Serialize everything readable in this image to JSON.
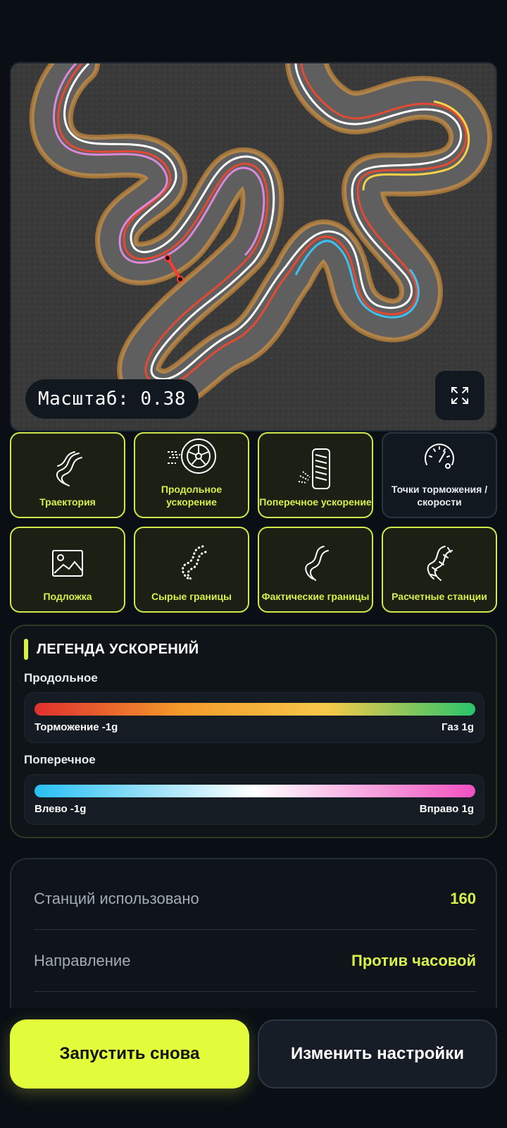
{
  "map": {
    "scale_text": "Масштаб: 0.38",
    "expand_icon": "expand-icon"
  },
  "layers": [
    {
      "label": "Траектория",
      "icon": "trajectory-icon",
      "active": true
    },
    {
      "label": "Продольное ускорение",
      "icon": "wheel-icon",
      "active": true
    },
    {
      "label": "Поперечное ускорение",
      "icon": "tire-icon",
      "active": true
    },
    {
      "label": "Точки торможения / скорости",
      "icon": "speedometer-icon",
      "active": false
    },
    {
      "label": "Подложка",
      "icon": "image-icon",
      "active": true
    },
    {
      "label": "Сырые границы",
      "icon": "dotted-road-icon",
      "active": true
    },
    {
      "label": "Фактические границы",
      "icon": "road-icon",
      "active": true
    },
    {
      "label": "Расчетные станции",
      "icon": "stations-icon",
      "active": true
    }
  ],
  "legend": {
    "title": "ЛЕГЕНДА УСКОРЕНИЙ",
    "longitudinal": {
      "label": "Продольное",
      "min_label": "Торможение -1g",
      "max_label": "Газ 1g",
      "colors": [
        "#e0302f",
        "#f39a2b",
        "#f6c94a",
        "#29c56b"
      ]
    },
    "lateral": {
      "label": "Поперечное",
      "min_label": "Влево -1g",
      "max_label": "Вправо 1g",
      "colors": [
        "#28bff2",
        "#ffffff",
        "#f050c0"
      ]
    }
  },
  "stats": [
    {
      "key": "Станций использовано",
      "value": "160"
    },
    {
      "key": "Направление",
      "value": "Против часовой"
    }
  ],
  "actions": {
    "restart": "Запустить снова",
    "settings": "Изменить настройки"
  },
  "accent": "#e2fb3a"
}
